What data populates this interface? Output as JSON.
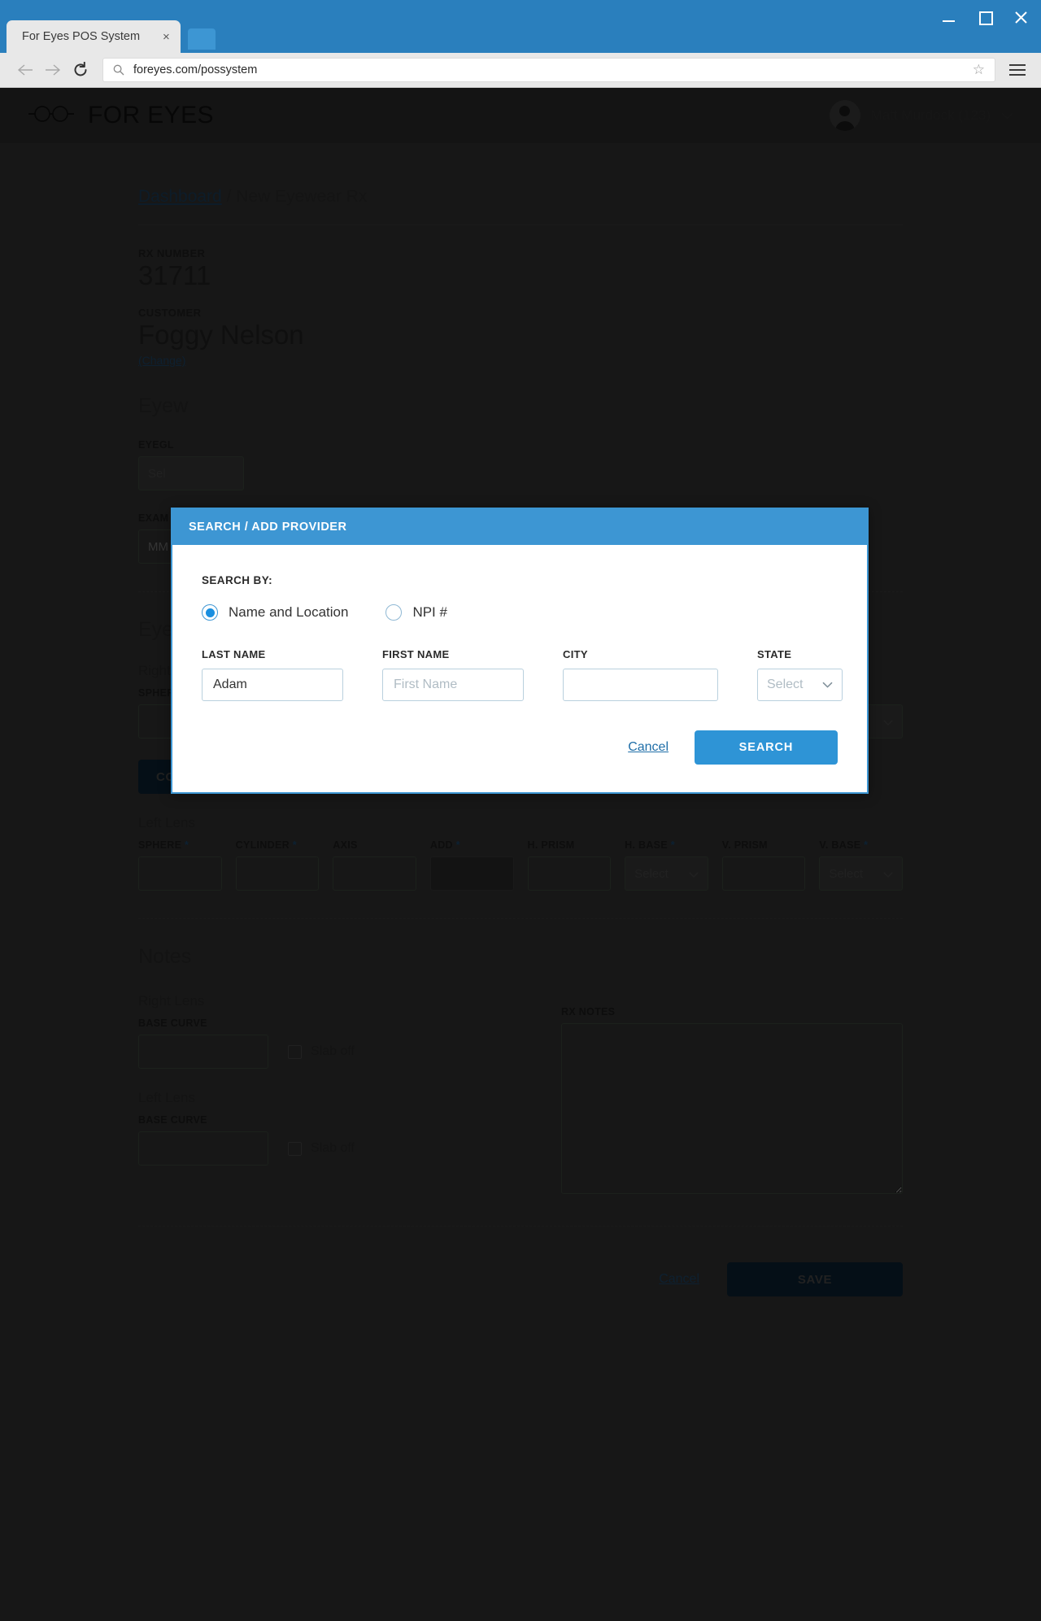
{
  "browser": {
    "tab_title": "For Eyes POS System",
    "tab_close": "×",
    "url": "foreyes.com/possystem",
    "back_icon": "back-arrow-icon",
    "forward_icon": "forward-arrow-icon",
    "reload_icon": "reload-icon",
    "star_icon": "bookmark-star-icon",
    "menu_icon": "hamburger-menu-icon",
    "minimize": "minimize-icon",
    "maximize": "maximize-icon",
    "close": "close-icon"
  },
  "app_header": {
    "brand_name": "FOR EYES",
    "logo_icon": "glasses-logo-icon",
    "user_name": "Matt Murdock (123)",
    "avatar_icon": "user-avatar-icon",
    "caret_icon": "chevron-down-icon"
  },
  "breadcrumb": {
    "home": "Dashboard",
    "separator": "/",
    "current": "New Eyewear Rx"
  },
  "rx": {
    "number_label": "RX NUMBER",
    "number_value": "31711",
    "customer_label": "CUSTOMER",
    "customer_value": "Foggy Nelson",
    "change_link": "(Change)"
  },
  "eyewear_section": {
    "title_partial": "Eyew",
    "eyeglass_label_partial": "EYEGL",
    "select_placeholder_partial": "Sel",
    "exam_label_partial": "EXAM",
    "exam_placeholder_partial": "MM"
  },
  "lens_section": {
    "title": "Eyeglass Lens Information",
    "right_lens_label": "Right Lens",
    "left_lens_label": "Left Lens",
    "columns": [
      {
        "label": "SPHERE",
        "required": true,
        "type": "input"
      },
      {
        "label": "CYLINDER",
        "required": true,
        "type": "input"
      },
      {
        "label": "AXIS",
        "required": false,
        "type": "input"
      },
      {
        "label": "ADD",
        "required": true,
        "type": "input-disabled"
      },
      {
        "label": "H. PRISM",
        "required": false,
        "type": "input"
      },
      {
        "label": "H. BASE",
        "required": true,
        "type": "select"
      },
      {
        "label": "V. PRISM",
        "required": false,
        "type": "input"
      },
      {
        "label": "V. BASE",
        "required": true,
        "type": "select"
      }
    ],
    "select_placeholder": "Select",
    "required_mark": "*",
    "copy_button": "COPY TO LEFT LENS",
    "right_values": [
      "",
      "",
      "",
      "",
      "",
      "",
      "",
      ""
    ],
    "left_values": [
      "",
      "",
      "",
      "",
      "",
      "",
      "",
      ""
    ]
  },
  "notes_section": {
    "title": "Notes",
    "right_lens_label": "Right Lens",
    "left_lens_label": "Left Lens",
    "base_curve_label": "BASE CURVE",
    "slab_off_label": "Slab off",
    "right_base_curve": "",
    "left_base_curve": "",
    "right_slab_off": false,
    "left_slab_off": false,
    "rx_notes_label": "RX NOTES",
    "rx_notes_value": ""
  },
  "footer": {
    "cancel_label": "Cancel",
    "save_label": "SAVE"
  },
  "modal": {
    "title": "SEARCH / ADD PROVIDER",
    "search_by_label": "SEARCH BY:",
    "radios": [
      {
        "label": "Name and Location",
        "checked": true
      },
      {
        "label": "NPI #",
        "checked": false
      }
    ],
    "fields": [
      {
        "label": "LAST NAME",
        "value": "Adam",
        "placeholder": "",
        "type": "input"
      },
      {
        "label": "FIRST NAME",
        "value": "",
        "placeholder": "First Name",
        "type": "input"
      },
      {
        "label": "CITY",
        "value": "",
        "placeholder": "",
        "type": "input"
      },
      {
        "label": "STATE",
        "value": "Select",
        "placeholder": "",
        "type": "select"
      }
    ],
    "cancel_label": "Cancel",
    "search_label": "SEARCH"
  },
  "colors": {
    "brand_blue": "#2a7fbd",
    "modal_blue": "#3d96d3",
    "button_blue": "#2e94d6",
    "app_dark": "#333333",
    "header_dark": "#2e2e2e",
    "dark_navy_button": "#0d2233"
  }
}
